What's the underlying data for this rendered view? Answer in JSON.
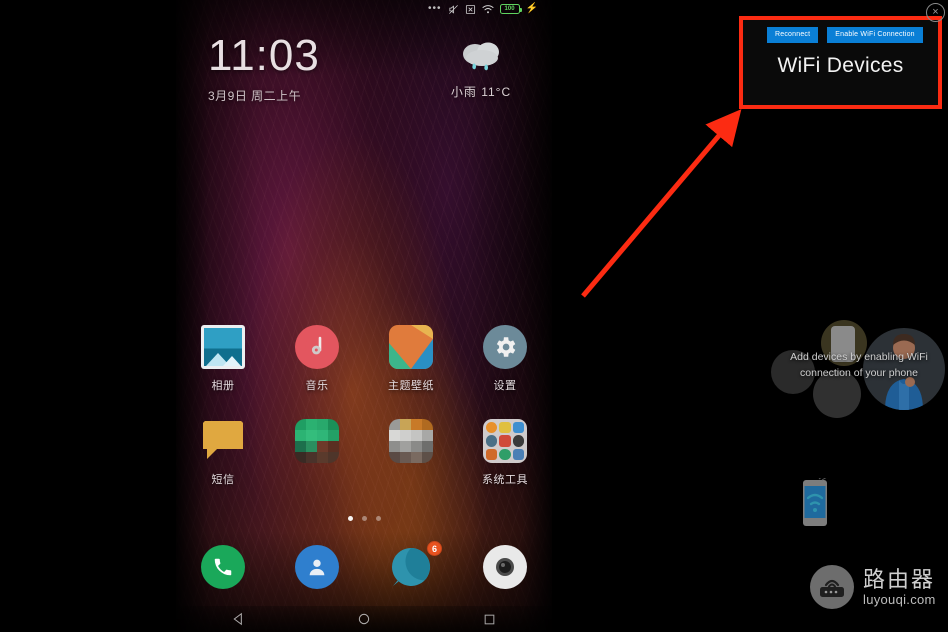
{
  "phone": {
    "status_bar": {
      "more_dots": "•••",
      "icons": [
        "mute-icon",
        "sim-x-icon",
        "wifi-icon"
      ],
      "battery_level": "100",
      "charging": "⚡"
    },
    "clock_widget": {
      "time": "11:03",
      "date": "3月9日 周二上午"
    },
    "weather_widget": {
      "icon": "rain-cloud-icon",
      "text": "小雨  11°C"
    },
    "apps": [
      [
        {
          "label": "相册",
          "icon": "gallery-icon"
        },
        {
          "label": "音乐",
          "icon": "music-icon"
        },
        {
          "label": "主题壁纸",
          "icon": "themes-icon"
        },
        {
          "label": "设置",
          "icon": "settings-icon"
        }
      ],
      [
        {
          "label": "短信",
          "icon": "sms-icon"
        },
        {
          "label": "",
          "icon": "mosaic-green-icon"
        },
        {
          "label": "",
          "icon": "mosaic-gray-icon"
        },
        {
          "label": "系统工具",
          "icon": "system-tools-folder-icon"
        }
      ]
    ],
    "page_dots": {
      "count": 3,
      "active": 1
    },
    "dock": [
      {
        "name": "phone-app",
        "icon": "phone-icon",
        "badge": ""
      },
      {
        "name": "contacts-app",
        "icon": "contacts-icon",
        "badge": ""
      },
      {
        "name": "browser-app",
        "icon": "browser-icon",
        "badge": "6"
      },
      {
        "name": "camera-app",
        "icon": "camera-icon",
        "badge": ""
      }
    ],
    "nav_bar": [
      "back-icon",
      "home-icon",
      "recents-icon"
    ]
  },
  "wifi_panel": {
    "title": "WiFi Devices",
    "reconnect_label": "Reconnect",
    "enable_label": "Enable WiFi Connection",
    "close_label": "×",
    "highlight_color": "#fc2b12",
    "button_color": "#0a7fd6"
  },
  "empty_state": {
    "line1": "Add devices by enabling WiFi",
    "line2": "connection of your phone"
  },
  "watermark": {
    "cn": "路由器",
    "en": "luyouqi.com",
    "icon": "router-icon"
  }
}
